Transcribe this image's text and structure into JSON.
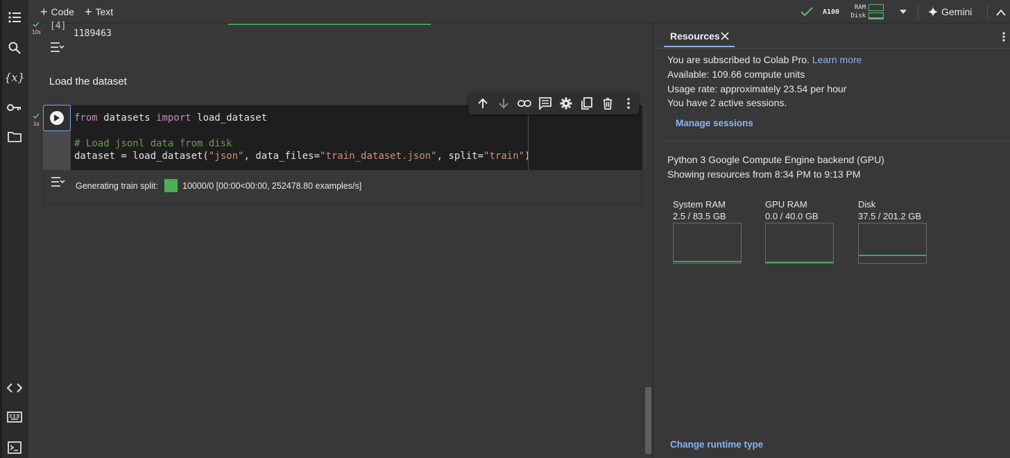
{
  "toolbar": {
    "code_label": "Code",
    "text_label": "Text",
    "runtime_gpu": "A100",
    "ram_label": "RAM",
    "disk_label": "Disk",
    "gemini_label": "Gemini"
  },
  "notebook": {
    "prev_cell": {
      "exec_count": "[4]",
      "exec_time": "10s",
      "output": "1189463"
    },
    "text_cell": "Load the dataset",
    "code_cell": {
      "exec_time": "1s",
      "lines": [
        {
          "kw1": "from",
          "t1": " datasets ",
          "kw2": "import",
          "t2": " load_dataset"
        },
        {
          "comment": "# Load jsonl data from disk"
        },
        {
          "t1": "dataset = load_dataset(",
          "s1": "\"json\"",
          "t2": ", data_files=",
          "s2": "\"train_dataset.json\"",
          "t3": ", split=",
          "s3": "\"train\"",
          "t4": ")"
        }
      ],
      "output_label": "Generating train split:",
      "output_progress": "10000/0 [00:00<00:00, 252478.80 examples/s]",
      "progress_color": "#4caf50"
    }
  },
  "panel": {
    "tab_label": "Resources",
    "line1_text": "You are subscribed to Colab Pro.",
    "line1_link": "Learn more",
    "line2": "Available: 109.66 compute units",
    "line3": "Usage rate: approximately 23.54 per hour",
    "line4": "You have 2 active sessions.",
    "manage_sessions": "Manage sessions",
    "backend": "Python 3 Google Compute Engine backend (GPU)",
    "showing": "Showing resources from 8:34 PM to 9:13 PM",
    "gauges": [
      {
        "name": "System RAM",
        "value": "2.5 / 83.5 GB",
        "fraction": 0.03
      },
      {
        "name": "GPU RAM",
        "value": "0.0 / 40.0 GB",
        "fraction": 0.0
      },
      {
        "name": "Disk",
        "value": "37.5 / 201.2 GB",
        "fraction": 0.19
      }
    ],
    "change_runtime": "Change runtime type"
  },
  "colors": {
    "accent": "#8ab4f8",
    "success": "#5bb974",
    "gauge_line": "#3aa757"
  },
  "icons": [
    "toc-icon",
    "search-icon",
    "variables-icon",
    "key-icon",
    "folder-icon",
    "code-snippets-icon",
    "command-palette-icon",
    "terminal-icon",
    "check-icon",
    "dropdown-arrow-icon",
    "sparkle-icon",
    "chevron-up-icon",
    "more-vert-icon",
    "close-icon",
    "run-icon",
    "output-collapse-icon",
    "arrow-up-icon",
    "arrow-down-icon",
    "link-icon",
    "comment-icon",
    "settings-icon",
    "mirror-cell-icon",
    "trash-icon"
  ]
}
